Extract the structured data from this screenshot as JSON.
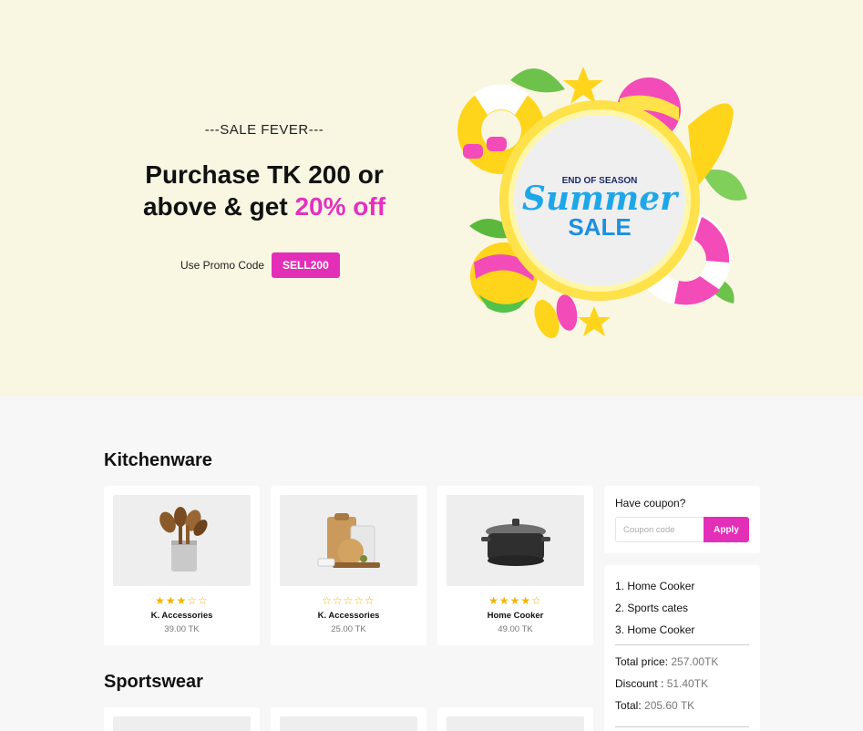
{
  "hero": {
    "tagline": "---SALE FEVER---",
    "headline_part1": "Purchase TK 200 or above & get ",
    "headline_accent": "20% off",
    "promo_label": "Use Promo Code",
    "promo_code": "SELL200",
    "banner_small": "END OF SEASON",
    "banner_big": "Summer",
    "banner_sale": "SALE"
  },
  "colors": {
    "accent": "#e32fb8",
    "hero_bg": "#f9f6e2",
    "star": "#f5b400"
  },
  "sections": {
    "kitchenware_title": "Kitchenware",
    "sportswear_title": "Sportswear"
  },
  "kitchenware": [
    {
      "name": "K. Accessories",
      "price": "39.00 TK",
      "rating": 3,
      "image": "wooden-spoons-image"
    },
    {
      "name": "K. Accessories",
      "price": "25.00 TK",
      "rating": 0,
      "image": "cutting-boards-image"
    },
    {
      "name": "Home Cooker",
      "price": "49.00 TK",
      "rating": 4,
      "image": "cooking-pot-image"
    }
  ],
  "coupon": {
    "title": "Have coupon?",
    "placeholder": "Coupon code",
    "apply_label": "Apply"
  },
  "cart": {
    "items": [
      "1. Home Cooker",
      "2. Sports cates",
      "3. Home Cooker"
    ],
    "total_price_label": "Total price:",
    "total_price_value": "257.00TK",
    "discount_label": "Discount :",
    "discount_value": "51.40TK",
    "total_label": "Total:",
    "total_value": "205.60 TK"
  }
}
